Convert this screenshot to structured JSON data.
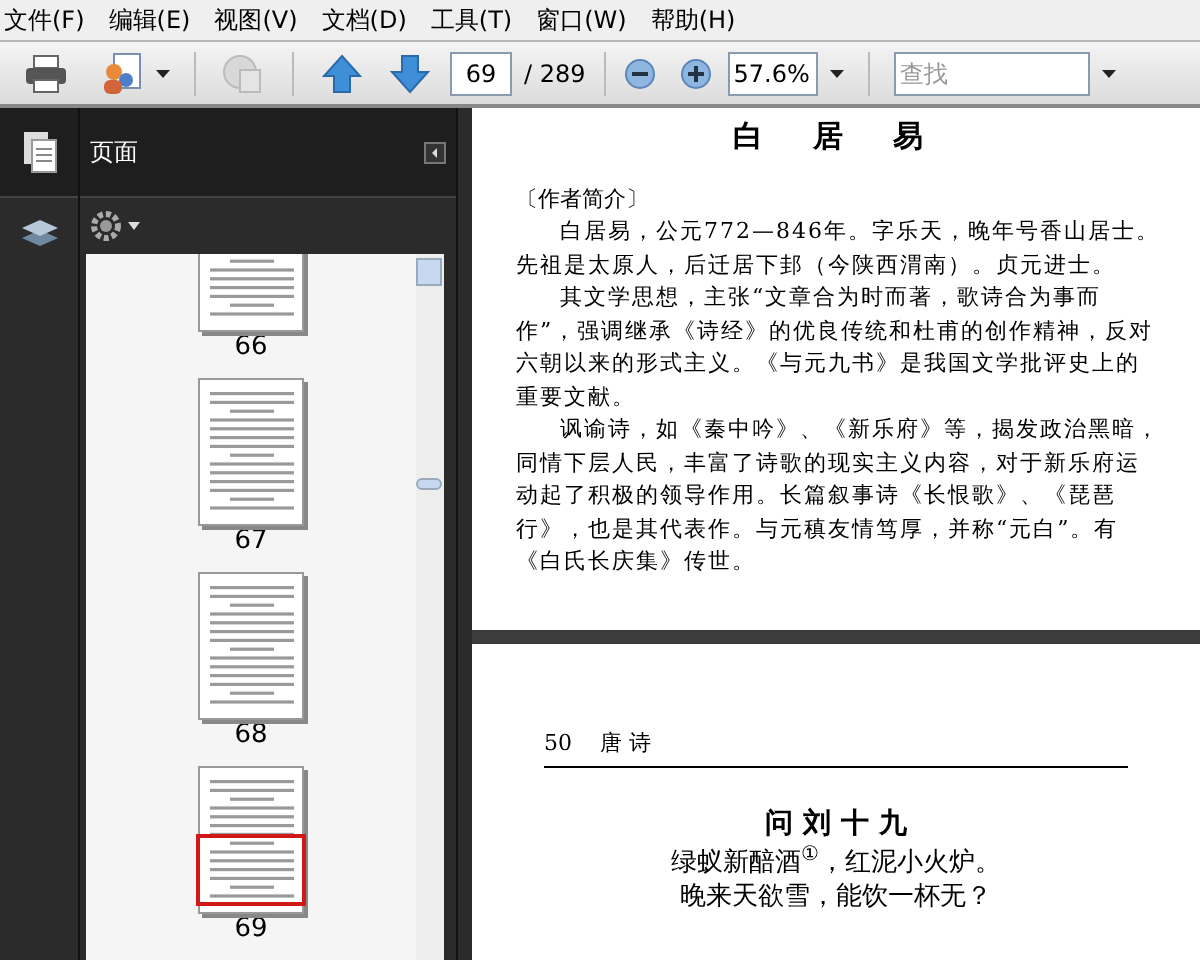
{
  "menu": [
    "文件(F)",
    "编辑(E)",
    "视图(V)",
    "文档(D)",
    "工具(T)",
    "窗口(W)",
    "帮助(H)"
  ],
  "toolbar": {
    "page_number": "69",
    "page_total": "/ 289",
    "zoom": "57.6%",
    "search": {
      "placeholder": "查找"
    }
  },
  "panel": {
    "title": "页面",
    "thumbnails": [
      {
        "label": "66",
        "selected": false
      },
      {
        "label": "67",
        "selected": false
      },
      {
        "label": "68",
        "selected": false
      },
      {
        "label": "69",
        "selected": true
      }
    ]
  },
  "document": {
    "pages": [
      {
        "title": "白 居 易",
        "section": "〔作者简介〕",
        "paragraphs": [
          "白居易，公元772—846年。字乐天，晚年号香山居士。先祖是太原人，后迁居下邽（今陕西渭南）。贞元进士。",
          "其文学思想，主张“文章合为时而著，歌诗合为事而作”，强调继承《诗经》的优良传统和杜甫的创作精神，反对六朝以来的形式主义。《与元九书》是我国文学批评史上的重要文献。",
          "讽谕诗，如《秦中吟》、《新乐府》等，揭发政治黑暗，同情下层人民，丰富了诗歌的现实主义内容，对于新乐府运动起了积极的领导作用。长篇叙事诗《长恨歌》、《琵琶行》，也是其代表作。与元稹友情笃厚，并称“元白”。有《白氏长庆集》传世。"
        ]
      },
      {
        "page_number": "50",
        "running_head": "唐 诗",
        "title": "问 刘 十 九",
        "lines": [
          "绿蚁新醅酒$^{①}$，红泥小火炉。",
          "晚来天欲雪，能饮一杯无？"
        ]
      }
    ]
  }
}
